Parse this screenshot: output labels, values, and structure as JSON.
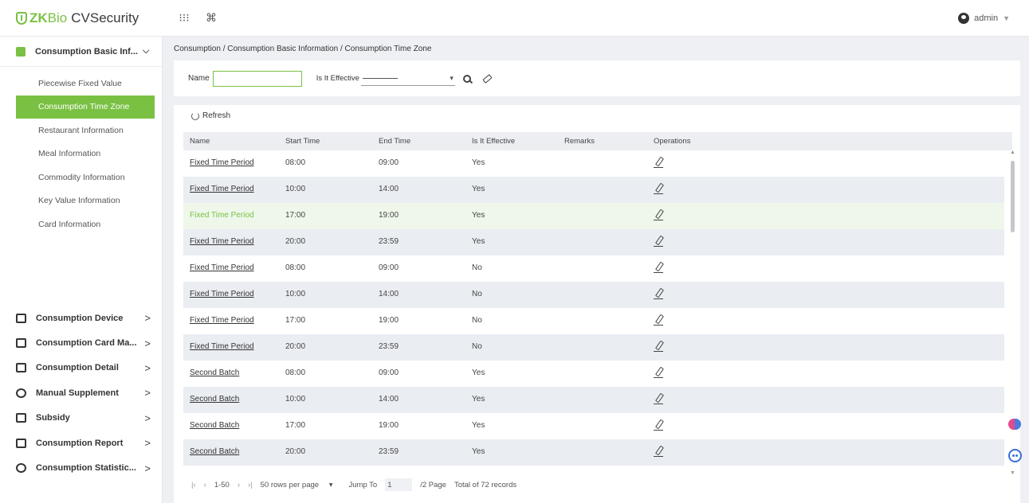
{
  "app": {
    "logo_zk": "ZK",
    "logo_bio": "Bio",
    "logo_product": "CVSecurity",
    "user": "admin"
  },
  "topbar": {
    "apps_icon": "grid-icon",
    "shortcut_icon": "command-icon"
  },
  "sidebar": {
    "module_title": "Consumption Basic Inf...",
    "sub_items": [
      {
        "label": "Piecewise Fixed Value",
        "active": false
      },
      {
        "label": "Consumption Time Zone",
        "active": true
      },
      {
        "label": "Restaurant Information",
        "active": false
      },
      {
        "label": "Meal Information",
        "active": false
      },
      {
        "label": "Commodity Information",
        "active": false
      },
      {
        "label": "Key Value Information",
        "active": false
      },
      {
        "label": "Card Information",
        "active": false
      }
    ],
    "groups": [
      {
        "label": "Consumption Device",
        "icon": "device-icon"
      },
      {
        "label": "Consumption Card Ma...",
        "icon": "card-icon"
      },
      {
        "label": "Consumption Detail",
        "icon": "detail-icon"
      },
      {
        "label": "Manual Supplement",
        "icon": "supplement-icon"
      },
      {
        "label": "Subsidy",
        "icon": "subsidy-icon"
      },
      {
        "label": "Consumption Report",
        "icon": "report-icon"
      },
      {
        "label": "Consumption Statistic...",
        "icon": "statistic-icon"
      }
    ],
    "arrow": ">"
  },
  "breadcrumb": "Consumption / Consumption Basic Information / Consumption Time Zone",
  "filter": {
    "name_label": "Name",
    "name_value": "",
    "effective_label": "Is It Effective",
    "effective_value": "",
    "caret": "▾"
  },
  "toolbar": {
    "refresh_label": "Refresh"
  },
  "table": {
    "headers": [
      "Name",
      "Start Time",
      "End Time",
      "Is It Effective",
      "Remarks",
      "Operations"
    ],
    "rows": [
      {
        "name": "Fixed Time Period",
        "start": "08:00",
        "end": "09:00",
        "effective": "Yes",
        "remarks": ""
      },
      {
        "name": "Fixed Time Period",
        "start": "10:00",
        "end": "14:00",
        "effective": "Yes",
        "remarks": ""
      },
      {
        "name": "Fixed Time Period",
        "start": "17:00",
        "end": "19:00",
        "effective": "Yes",
        "remarks": ""
      },
      {
        "name": "Fixed Time Period",
        "start": "20:00",
        "end": "23:59",
        "effective": "Yes",
        "remarks": ""
      },
      {
        "name": "Fixed Time Period",
        "start": "08:00",
        "end": "09:00",
        "effective": "No",
        "remarks": ""
      },
      {
        "name": "Fixed Time Period",
        "start": "10:00",
        "end": "14:00",
        "effective": "No",
        "remarks": ""
      },
      {
        "name": "Fixed Time Period",
        "start": "17:00",
        "end": "19:00",
        "effective": "No",
        "remarks": ""
      },
      {
        "name": "Fixed Time Period",
        "start": "20:00",
        "end": "23:59",
        "effective": "No",
        "remarks": ""
      },
      {
        "name": "Second Batch",
        "start": "08:00",
        "end": "09:00",
        "effective": "Yes",
        "remarks": ""
      },
      {
        "name": "Second Batch",
        "start": "10:00",
        "end": "14:00",
        "effective": "Yes",
        "remarks": ""
      },
      {
        "name": "Second Batch",
        "start": "17:00",
        "end": "19:00",
        "effective": "Yes",
        "remarks": ""
      },
      {
        "name": "Second Batch",
        "start": "20:00",
        "end": "23:59",
        "effective": "Yes",
        "remarks": ""
      }
    ],
    "hovered_row": 2
  },
  "pager": {
    "first": "|‹",
    "prev": "‹",
    "range": "1-50",
    "next": "›",
    "last": "›|",
    "rows_per_page": "50 rows per page",
    "caret": "▾",
    "jump_label": "Jump To",
    "jump_value": "1",
    "pages": "/2 Page",
    "total": "Total of 72 records"
  },
  "colors": {
    "accent": "#7ac143",
    "row_alt": "#eaedf2",
    "row_hover": "#eef7ea"
  }
}
